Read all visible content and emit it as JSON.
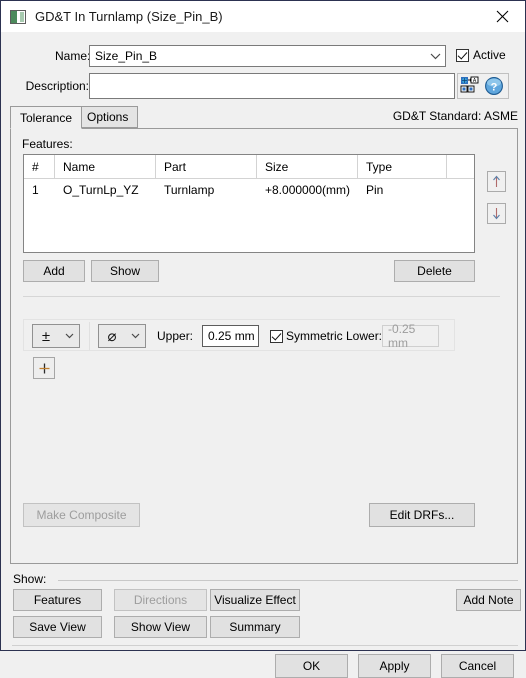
{
  "window": {
    "title": "GD&T In Turnlamp (Size_Pin_B)",
    "icon": "gdt-window-icon",
    "close_icon": "close-icon",
    "border_color": "#2c3251"
  },
  "name_row": {
    "label": "Name:",
    "value": "Size_Pin_B",
    "dropdown_icon": "chevron-down-icon",
    "active_label": "Active",
    "active_checked": true
  },
  "description_row": {
    "label": "Description:",
    "value": "",
    "placeholder": "",
    "gdt_tool_icon": "gdt-frame-icon",
    "help_icon": "help-question-icon"
  },
  "tabs": {
    "items": [
      {
        "label": "Tolerance",
        "active": true
      },
      {
        "label": "Options",
        "active": false
      }
    ],
    "standard_text": "GD&T Standard: ASME"
  },
  "features": {
    "label": "Features:",
    "columns": [
      "#",
      "Name",
      "Part",
      "Size",
      "Type",
      ""
    ],
    "rows": [
      {
        "num": "1",
        "name": "O_TurnLp_YZ",
        "part": "Turnlamp",
        "size": "+8.000000(mm)",
        "type": "Pin",
        "extra": ""
      }
    ],
    "move_up_icon": "arrow-up-icon",
    "move_down_icon": "arrow-down-icon",
    "add_label": "Add",
    "show_label": "Show",
    "delete_label": "Delete"
  },
  "tolerance": {
    "modifier_symbol": "±",
    "modifier_caret_icon": "chevron-down-icon",
    "diameter_symbol": "⌀",
    "diameter_caret_icon": "chevron-down-icon",
    "upper_label": "Upper:",
    "upper_value": "0.25 mm",
    "symmetric_lower_label": "Symmetric Lower:",
    "symmetric_lower_checked": true,
    "lower_value": "-0.25 mm",
    "add_row_label": "+",
    "add_row_icon": "plus-icon"
  },
  "panel_buttons": {
    "make_composite_label": "Make Composite",
    "make_composite_enabled": false,
    "edit_drfs_label": "Edit DRFs..."
  },
  "show_group": {
    "label": "Show:",
    "buttons": [
      {
        "label": "Features",
        "enabled": true
      },
      {
        "label": "Directions",
        "enabled": false
      },
      {
        "label": "Visualize Effect",
        "enabled": true
      },
      {
        "label": "Add Note",
        "enabled": true
      },
      {
        "label": "Save View",
        "enabled": true
      },
      {
        "label": "Show View",
        "enabled": true
      },
      {
        "label": "Summary",
        "enabled": true
      }
    ]
  },
  "footer": {
    "ok_label": "OK",
    "apply_label": "Apply",
    "cancel_label": "Cancel"
  }
}
